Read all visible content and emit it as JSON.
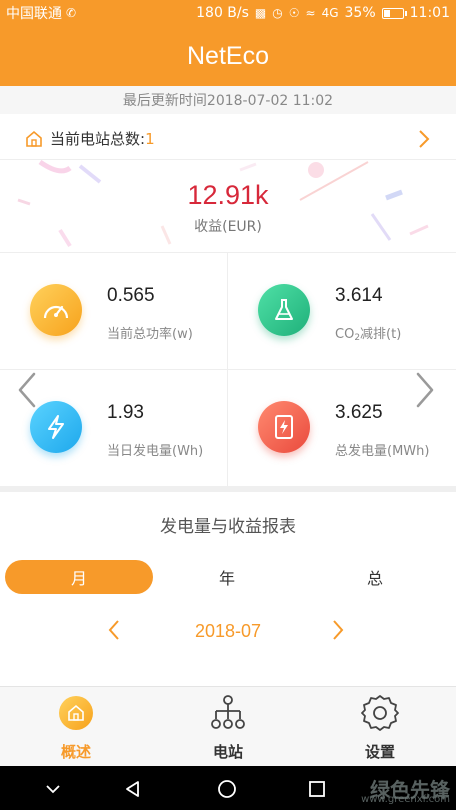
{
  "status_bar": {
    "carrier": "中国联通",
    "speed": "180 B/s",
    "signal": "4G",
    "battery_percent": "35%",
    "battery_level": 0.35,
    "time": "11:01"
  },
  "app_bar": {
    "title": "NetEco"
  },
  "last_update": "最后更新时间2018-07-02 11:02",
  "station_count": {
    "label": "当前电站总数:",
    "value": "1"
  },
  "revenue": {
    "value": "12.91k",
    "caption": "收益(EUR)"
  },
  "metrics": [
    {
      "value": "0.565",
      "label": "当前总功率(w)",
      "icon": "gauge-icon"
    },
    {
      "value": "3.614",
      "label_prefix": "CO",
      "label_sub": "2",
      "label_suffix": "减排(t)",
      "icon": "flask-icon"
    },
    {
      "value": "1.93",
      "label": "当日发电量(Wh)",
      "icon": "lightning-icon"
    },
    {
      "value": "3.625",
      "label": "总发电量(MWh)",
      "icon": "power-document-icon"
    }
  ],
  "report": {
    "title": "发电量与收益报表",
    "tabs": [
      "月",
      "年",
      "总"
    ],
    "active_tab": "月",
    "period": "2018-07"
  },
  "bottom_nav": [
    {
      "label": "概述",
      "icon": "home-icon",
      "active": true
    },
    {
      "label": "电站",
      "icon": "station-tree-icon",
      "active": false
    },
    {
      "label": "设置",
      "icon": "gear-icon",
      "active": false
    }
  ],
  "watermark": {
    "text": "绿色先锋",
    "url": "www.greenxf.com"
  },
  "colors": {
    "accent": "#f79a2a",
    "revenue": "#d7283a"
  }
}
